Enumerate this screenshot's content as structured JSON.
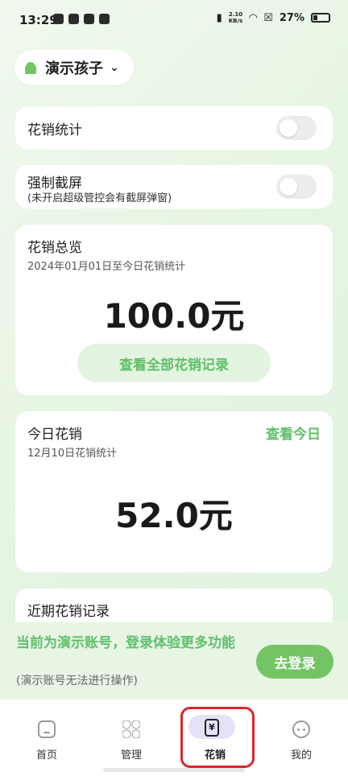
{
  "status": {
    "time": "13:29",
    "speed_top": "2.10",
    "speed_bottom": "KB/s",
    "battery": "27%"
  },
  "child_selector": {
    "name": "演示孩子",
    "chevron": "⌄"
  },
  "settings": {
    "spend_stats": {
      "title": "花销统计",
      "enabled": false
    },
    "force_screenshot": {
      "title": "强制截屏",
      "subtitle": "(未开启超级管控会有截屏弹窗)",
      "enabled": false
    }
  },
  "overview": {
    "title": "花销总览",
    "subtitle": "2024年01月01日至今日花销统计",
    "amount": "100.0元",
    "button": "查看全部花销记录"
  },
  "today": {
    "title": "今日花销",
    "link": "查看今日",
    "subtitle": "12月10日花销统计",
    "amount": "52.0元"
  },
  "recent": {
    "title": "近期花销记录"
  },
  "login_banner": {
    "message": "当前为演示账号，登录体验更多功能",
    "note": "(演示账号无法进行操作)",
    "button": "去登录"
  },
  "nav": {
    "items": [
      {
        "label": "首页",
        "icon": "home-icon"
      },
      {
        "label": "管理",
        "icon": "grid-icon"
      },
      {
        "label": "花销",
        "icon": "yuan-phone-icon",
        "active": true
      },
      {
        "label": "我的",
        "icon": "face-icon"
      }
    ],
    "spend_symbol": "¥"
  },
  "colors": {
    "accent": "#5fbf6a",
    "highlight": "#e0242a"
  }
}
